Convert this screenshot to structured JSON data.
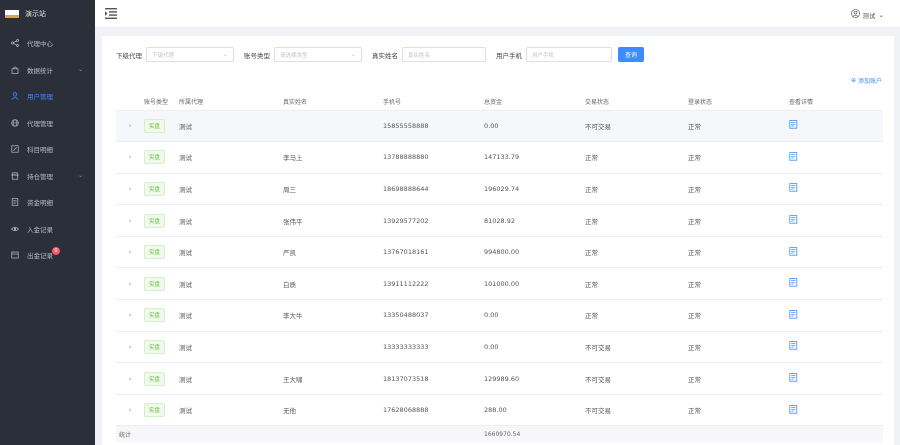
{
  "app": {
    "title": "演示站"
  },
  "sidebar": {
    "items": [
      {
        "label": "代理中心",
        "icon": "share-icon",
        "arrow": false,
        "active": false
      },
      {
        "label": "数据统计",
        "icon": "bag-icon",
        "arrow": true,
        "active": false
      },
      {
        "label": "用户管理",
        "icon": "user-icon",
        "arrow": false,
        "active": true
      },
      {
        "label": "代理管理",
        "icon": "globe-icon",
        "arrow": false,
        "active": false
      },
      {
        "label": "科目明细",
        "icon": "edit-icon",
        "arrow": false,
        "active": false
      },
      {
        "label": "持仓管理",
        "icon": "shop-icon",
        "arrow": true,
        "active": false
      },
      {
        "label": "资金明细",
        "icon": "document-icon",
        "arrow": false,
        "active": false
      },
      {
        "label": "入金记录",
        "icon": "eye-icon",
        "arrow": false,
        "active": false
      },
      {
        "label": "出金记录",
        "icon": "list-icon",
        "arrow": false,
        "active": false,
        "badge": "0"
      }
    ]
  },
  "header": {
    "user_label": "测试"
  },
  "filters": {
    "agent_label": "下级代理",
    "agent_placeholder": "下级代理",
    "type_label": "账号类型",
    "type_placeholder": "请选择类型",
    "name_label": "真实姓名",
    "name_placeholder": "真实姓名",
    "phone_label": "用户手机",
    "phone_placeholder": "用户手机",
    "search_label": "查询"
  },
  "add_link": "添加账户",
  "table": {
    "columns": [
      "账号类型",
      "所属代理",
      "真实姓名",
      "手机号",
      "总资金",
      "交易状态",
      "登录状态",
      "查看详情"
    ],
    "rows": [
      {
        "type": "实盘",
        "agent": "测试",
        "name": "",
        "phone": "15855558888",
        "funds": "0.00",
        "trade": "不可交易",
        "login": "正常"
      },
      {
        "type": "实盘",
        "agent": "测试",
        "name": "李马上",
        "phone": "13788888880",
        "funds": "147133.79",
        "trade": "正常",
        "login": "正常"
      },
      {
        "type": "实盘",
        "agent": "测试",
        "name": "周三",
        "phone": "18698888644",
        "funds": "196029.74",
        "trade": "正常",
        "login": "正常"
      },
      {
        "type": "实盘",
        "agent": "测试",
        "name": "张伟平",
        "phone": "13929577202",
        "funds": "81028.92",
        "trade": "正常",
        "login": "正常"
      },
      {
        "type": "实盘",
        "agent": "测试",
        "name": "严凯",
        "phone": "13767018161",
        "funds": "994800.00",
        "trade": "正常",
        "login": "正常"
      },
      {
        "type": "实盘",
        "agent": "测试",
        "name": "白质",
        "phone": "13911112222",
        "funds": "101000.00",
        "trade": "正常",
        "login": "正常"
      },
      {
        "type": "实盘",
        "agent": "测试",
        "name": "李大牛",
        "phone": "13350488037",
        "funds": "0.00",
        "trade": "正常",
        "login": "正常"
      },
      {
        "type": "实盘",
        "agent": "测试",
        "name": "",
        "phone": "13333333333",
        "funds": "0.00",
        "trade": "不可交易",
        "login": "正常"
      },
      {
        "type": "实盘",
        "agent": "测试",
        "name": "王大啸",
        "phone": "18137073518",
        "funds": "129989.60",
        "trade": "不可交易",
        "login": "正常"
      },
      {
        "type": "实盘",
        "agent": "测试",
        "name": "无他",
        "phone": "17628068888",
        "funds": "288.00",
        "trade": "不可交易",
        "login": "正常"
      }
    ],
    "footer_label": "统计",
    "footer_total": "1660970.54"
  },
  "colors": {
    "sidebar": "#2b2f3a",
    "accent": "#3d8bfd",
    "tag_green": "#67c23a"
  }
}
